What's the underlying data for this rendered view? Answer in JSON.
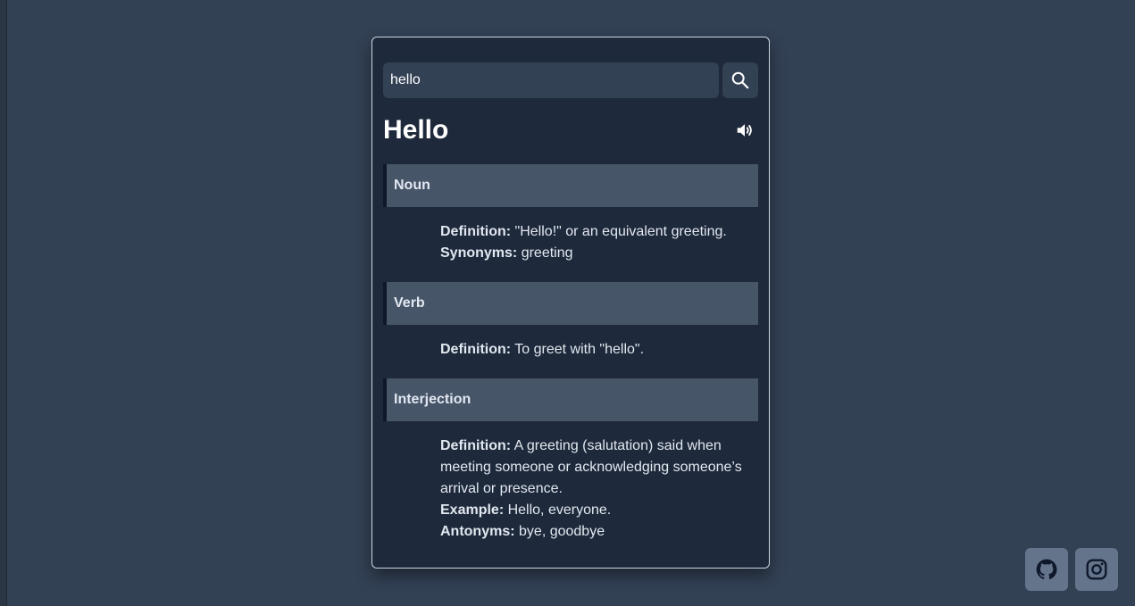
{
  "search": {
    "value": "hello",
    "button_icon": "search-icon"
  },
  "word": {
    "title": "Hello",
    "audio_icon": "speaker-icon"
  },
  "meanings": [
    {
      "part_of_speech": "Noun",
      "definition_label": "Definition:",
      "definition": "\"Hello!\" or an equivalent greeting.",
      "synonyms_label": "Synonyms:",
      "synonyms": "greeting"
    },
    {
      "part_of_speech": "Verb",
      "definition_label": "Definition:",
      "definition": "To greet with \"hello\"."
    },
    {
      "part_of_speech": "Interjection",
      "definition_label": "Definition:",
      "definition": "A greeting (salutation) said when meeting someone or acknowledging someone’s arrival or presence.",
      "example_label": "Example:",
      "example": "Hello, everyone.",
      "antonyms_label": "Antonyms:",
      "antonyms": "bye, goodbye"
    }
  ],
  "social_links": [
    {
      "icon": "github-icon"
    },
    {
      "icon": "instagram-icon"
    }
  ],
  "colors": {
    "page_background": "#334155",
    "card_background": "#1e293b",
    "input_background": "#334155",
    "pos_header_background": "#475569",
    "social_button_background": "#64748b",
    "text": "#e2e8f0"
  }
}
